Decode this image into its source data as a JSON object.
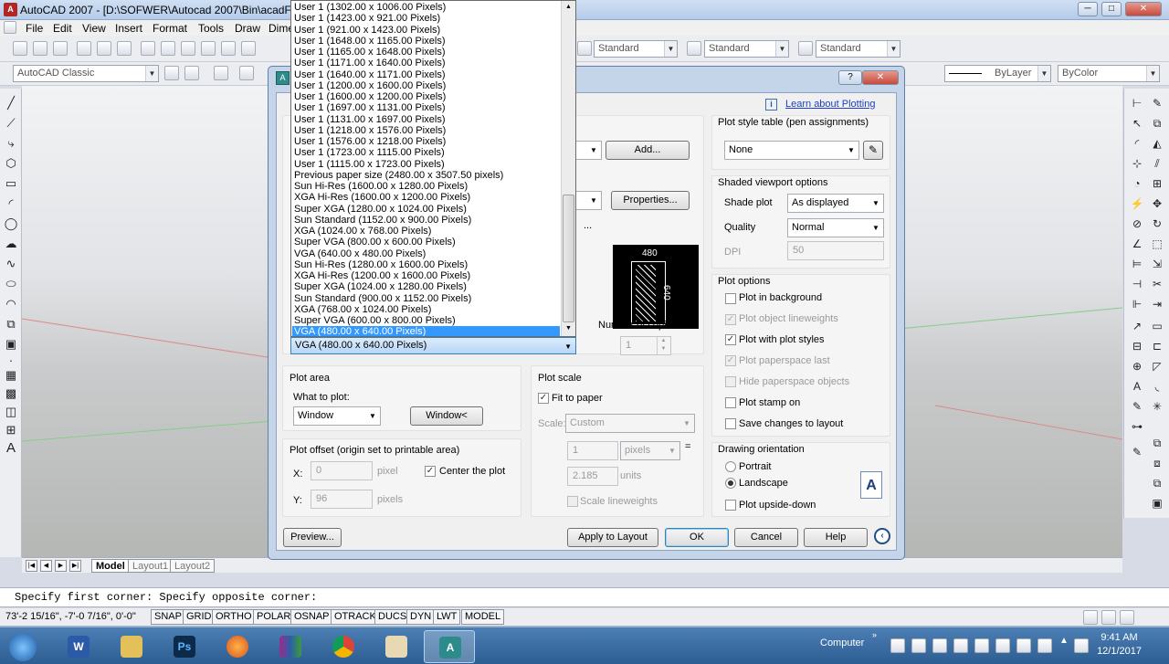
{
  "window": {
    "title": "AutoCAD 2007 - [D:\\SOFWER\\Autocad 2007\\Bin\\acadFeu\\P",
    "btn_min": "─",
    "btn_max": "□",
    "btn_close": "✕"
  },
  "menu": [
    "File",
    "Edit",
    "View",
    "Insert",
    "Format",
    "Tools",
    "Draw",
    "Dime"
  ],
  "toolbar": {
    "workspace": "AutoCAD Classic",
    "text_style": "Standard",
    "dim_style": "Standard",
    "table_style": "Standard",
    "linetype": "ByLayer",
    "color": "ByColor"
  },
  "dialog": {
    "help_btn": "?",
    "close_btn": "✕",
    "learn_link": "Learn about Plotting",
    "add_btn": "Add...",
    "properties_btn": "Properties...",
    "preview_width": "480",
    "preview_height": "640",
    "paper_size_selected": "VGA (480.00 x 640.00 Pixels)",
    "copies_label": "Number of copies",
    "copies_value": "1",
    "plot_area": {
      "title": "Plot area",
      "what_label": "What to plot:",
      "what_value": "Window",
      "window_btn": "Window<"
    },
    "plot_offset": {
      "title": "Plot offset (origin set to printable area)",
      "x_label": "X:",
      "x_value": "0",
      "x_unit": "pixel",
      "y_label": "Y:",
      "y_value": "96",
      "y_unit": "pixels",
      "center_label": "Center the plot"
    },
    "plot_scale": {
      "title": "Plot scale",
      "fit_label": "Fit to paper",
      "scale_label": "Scale:",
      "scale_value": "Custom",
      "num_value": "1",
      "num_unit": "pixels",
      "equals": "=",
      "den_value": "2.185",
      "den_unit": "units",
      "lineweights_label": "Scale lineweights"
    },
    "style_table": {
      "title": "Plot style table (pen assignments)",
      "value": "None"
    },
    "shaded": {
      "title": "Shaded viewport options",
      "shade_label": "Shade plot",
      "shade_value": "As displayed",
      "quality_label": "Quality",
      "quality_value": "Normal",
      "dpi_label": "DPI",
      "dpi_value": "50"
    },
    "plot_options": {
      "title": "Plot options",
      "items": [
        {
          "label": "Plot in background",
          "checked": false,
          "enabled": true
        },
        {
          "label": "Plot object lineweights",
          "checked": true,
          "enabled": false
        },
        {
          "label": "Plot with plot styles",
          "checked": true,
          "enabled": true
        },
        {
          "label": "Plot paperspace last",
          "checked": true,
          "enabled": false
        },
        {
          "label": "Hide paperspace objects",
          "checked": false,
          "enabled": false
        },
        {
          "label": "Plot stamp on",
          "checked": false,
          "enabled": true
        },
        {
          "label": "Save changes to layout",
          "checked": false,
          "enabled": true
        }
      ]
    },
    "orientation": {
      "title": "Drawing orientation",
      "portrait": "Portrait",
      "landscape": "Landscape",
      "upside_down": "Plot upside-down",
      "glyph": "A"
    },
    "footer": {
      "preview_btn": "Preview...",
      "apply_btn": "Apply to Layout",
      "ok_btn": "OK",
      "cancel_btn": "Cancel",
      "help_btn": "Help"
    },
    "paper_sizes": [
      "User 1 (1302.00 x 1006.00 Pixels)",
      "User 1 (1423.00 x 921.00 Pixels)",
      "User 1 (921.00 x 1423.00 Pixels)",
      "User 1 (1648.00 x 1165.00 Pixels)",
      "User 1 (1165.00 x 1648.00 Pixels)",
      "User 1 (1171.00 x 1640.00 Pixels)",
      "User 1 (1640.00 x 1171.00 Pixels)",
      "User 1 (1200.00 x 1600.00 Pixels)",
      "User 1 (1600.00 x 1200.00 Pixels)",
      "User 1 (1697.00 x 1131.00 Pixels)",
      "User 1 (1131.00 x 1697.00 Pixels)",
      "User 1 (1218.00 x 1576.00 Pixels)",
      "User 1 (1576.00 x 1218.00 Pixels)",
      "User 1 (1723.00 x 1115.00 Pixels)",
      "User 1 (1115.00 x 1723.00 Pixels)",
      "Previous paper size  (2480.00 x 3507.50 pixels)",
      "Sun Hi-Res (1600.00 x 1280.00 Pixels)",
      "XGA Hi-Res (1600.00 x 1200.00 Pixels)",
      "Super XGA (1280.00 x 1024.00 Pixels)",
      "Sun Standard (1152.00 x 900.00 Pixels)",
      "XGA (1024.00 x 768.00 Pixels)",
      "Super VGA (800.00 x 600.00 Pixels)",
      "VGA (640.00 x 480.00 Pixels)",
      "Sun Hi-Res (1280.00 x 1600.00 Pixels)",
      "XGA Hi-Res (1200.00 x 1600.00 Pixels)",
      "Super XGA (1024.00 x 1280.00 Pixels)",
      "Sun Standard (900.00 x 1152.00 Pixels)",
      "XGA (768.00 x 1024.00 Pixels)",
      "Super VGA (600.00 x 800.00 Pixels)",
      "VGA (480.00 x 640.00 Pixels)"
    ]
  },
  "layout_tabs": [
    "Model",
    "Layout1",
    "Layout2"
  ],
  "command_line": "Specify first corner: Specify opposite corner:",
  "status": {
    "coords": "73'-2 15/16\", -7'-0 7/16\", 0'-0\"",
    "buttons": [
      "SNAP",
      "GRID",
      "ORTHO",
      "POLAR",
      "OSNAP",
      "OTRACK",
      "DUCS",
      "DYN",
      "LWT",
      "MODEL"
    ]
  },
  "taskbar": {
    "computer": "Computer",
    "time": "9:41 AM",
    "date": "12/1/2017"
  },
  "colors": {
    "accent": "#3399ff",
    "taskbar": "#2c5d93",
    "close_red": "#c9483c"
  }
}
